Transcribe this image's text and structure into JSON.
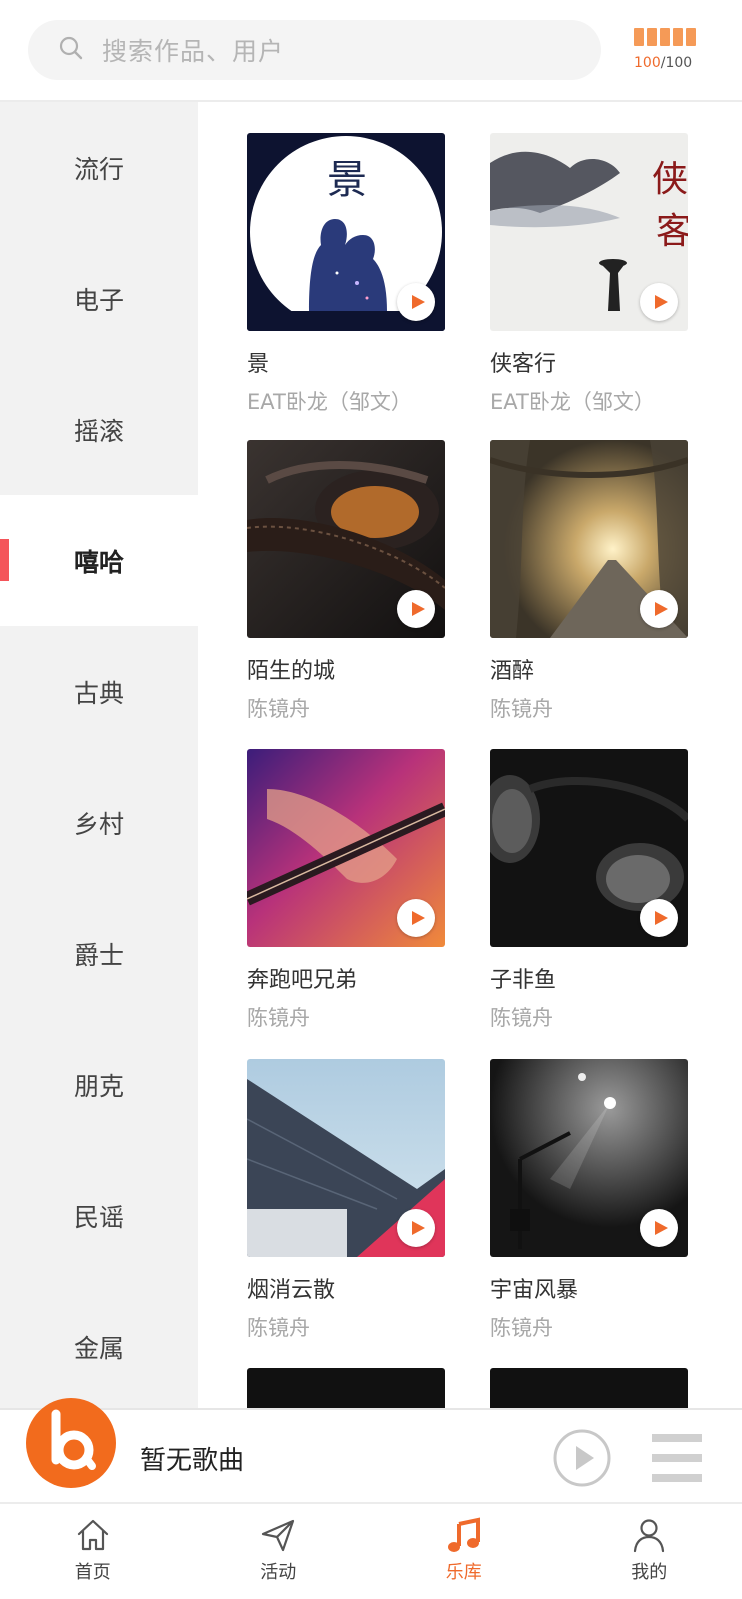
{
  "search": {
    "placeholder": "搜索作品、用户"
  },
  "quota": {
    "current": "100",
    "total": "/100"
  },
  "categories": [
    {
      "label": "流行",
      "active": false
    },
    {
      "label": "电子",
      "active": false
    },
    {
      "label": "摇滚",
      "active": false
    },
    {
      "label": "嘻哈",
      "active": true
    },
    {
      "label": "古典",
      "active": false
    },
    {
      "label": "乡村",
      "active": false
    },
    {
      "label": "爵士",
      "active": false
    },
    {
      "label": "朋克",
      "active": false
    },
    {
      "label": "民谣",
      "active": false
    },
    {
      "label": "金属",
      "active": false
    }
  ],
  "songs": [
    {
      "title": "景",
      "artist": "EAT卧龙（邹文）",
      "cover": "scenery-couple-galaxy"
    },
    {
      "title": "侠客行",
      "artist": "EAT卧龙（邹文）",
      "cover": "ink-wash-swordsman"
    },
    {
      "title": "陌生的城",
      "artist": "陈镜舟",
      "cover": "leather-headphones"
    },
    {
      "title": "酒醉",
      "artist": "陈镜舟",
      "cover": "tree-tunnel-road"
    },
    {
      "title": "奔跑吧兄弟",
      "artist": "陈镜舟",
      "cover": "guitar-hand-gradient"
    },
    {
      "title": "子非鱼",
      "artist": "陈镜舟",
      "cover": "headphones-dark"
    },
    {
      "title": "烟消云散",
      "artist": "陈镜舟",
      "cover": "building-sky-red"
    },
    {
      "title": "宇宙风暴",
      "artist": "陈镜舟",
      "cover": "stage-microphone-light"
    }
  ],
  "player": {
    "now_playing": "暂无歌曲"
  },
  "nav": [
    {
      "label": "首页",
      "icon": "home-icon"
    },
    {
      "label": "活动",
      "icon": "paper-plane-icon"
    },
    {
      "label": "乐库",
      "icon": "music-note-icon",
      "active": true
    },
    {
      "label": "我的",
      "icon": "person-icon"
    }
  ],
  "colors": {
    "accent": "#ef6a2c",
    "indicator": "#f4545a",
    "sidebar_bg": "#f2f2f2"
  }
}
